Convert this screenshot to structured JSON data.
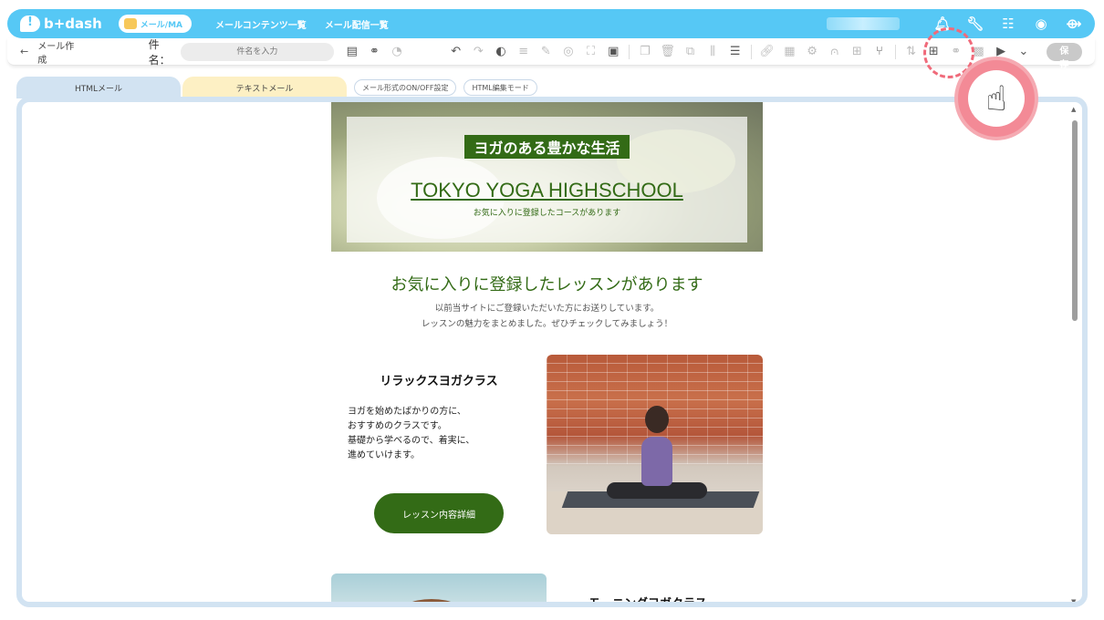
{
  "header": {
    "logo_text": "b+dash",
    "mode_label": "メール/MA",
    "nav": [
      "メールコンテンツ一覧",
      "メール配信一覧"
    ],
    "icons": [
      "bell-icon",
      "wrench-icon",
      "grid-icon",
      "chat-bot-icon",
      "logout-icon"
    ]
  },
  "toolbar": {
    "back_label": "←",
    "breadcrumb": "メール作成",
    "subject_label": "件名：",
    "subject_placeholder": "件名を入力",
    "save_label": "保存"
  },
  "tabs": {
    "html_label": "HTMLメール",
    "text_label": "テキストメール",
    "toggle_label": "メール形式のON/OFF設定",
    "editmode_label": "HTML編集モード"
  },
  "mail": {
    "hero_tag": "ヨガのある豊かな生活",
    "hero_title": "TOKYO YOGA HIGHSCHOOL",
    "hero_sub": "お気に入りに登録したコースがあります",
    "lead_title": "お気に入りに登録したレッスンがあります",
    "lead_line1": "以前当サイトにご登録いただいた方にお送りしています。",
    "lead_line2": "レッスンの魅力をまとめました。ぜひチェックしてみましょう！",
    "course1": {
      "name": "リラックスヨガクラス",
      "desc_line1": "ヨガを始めたばかりの方に、",
      "desc_line2": "おすすめのクラスです。",
      "desc_line3": "基礎から学べるので、着実に、",
      "desc_line4": "進めていけます。",
      "button": "レッスン内容詳細"
    },
    "course2": {
      "name": "モーニングヨガクラス"
    }
  },
  "colors": {
    "brand_blue": "#56c8f5",
    "accent_green": "#336b16",
    "highlight_pink": "#f06a7a"
  }
}
